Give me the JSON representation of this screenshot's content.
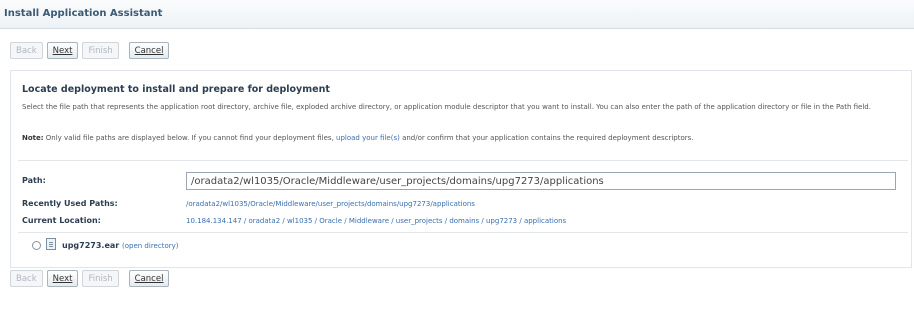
{
  "window": {
    "title": "Install Application Assistant"
  },
  "buttons": {
    "back": "Back",
    "next": "Next",
    "finish": "Finish",
    "cancel": "Cancel"
  },
  "section": {
    "heading": "Locate deployment to install and prepare for deployment",
    "description": "Select the file path that represents the application root directory, archive file, exploded archive directory, or application module descriptor that you want to install. You can also enter the path of the application directory or file in the Path field.",
    "note_label": "Note:",
    "note_text_1": " Only valid file paths are displayed below. If you cannot find your deployment files, ",
    "note_link": "upload your file(s)",
    "note_text_2": " and/or confirm that your application contains the required deployment descriptors."
  },
  "form": {
    "path_label": "Path:",
    "path_value": "/oradata2/wl1035/Oracle/Middleware/user_projects/domains/upg7273/applications",
    "recent_label": "Recently Used Paths:",
    "recent_value": "/oradata2/wl1035/Oracle/Middleware/user_projects/domains/upg7273/applications",
    "location_label": "Current Location:",
    "location_value": "10.184.134.147 / oradata2 / wl1035 / Oracle / Middleware / user_projects / domains / upg7273 / applications"
  },
  "files": [
    {
      "name": "upg7273.ear",
      "action": "(open directory)"
    }
  ]
}
